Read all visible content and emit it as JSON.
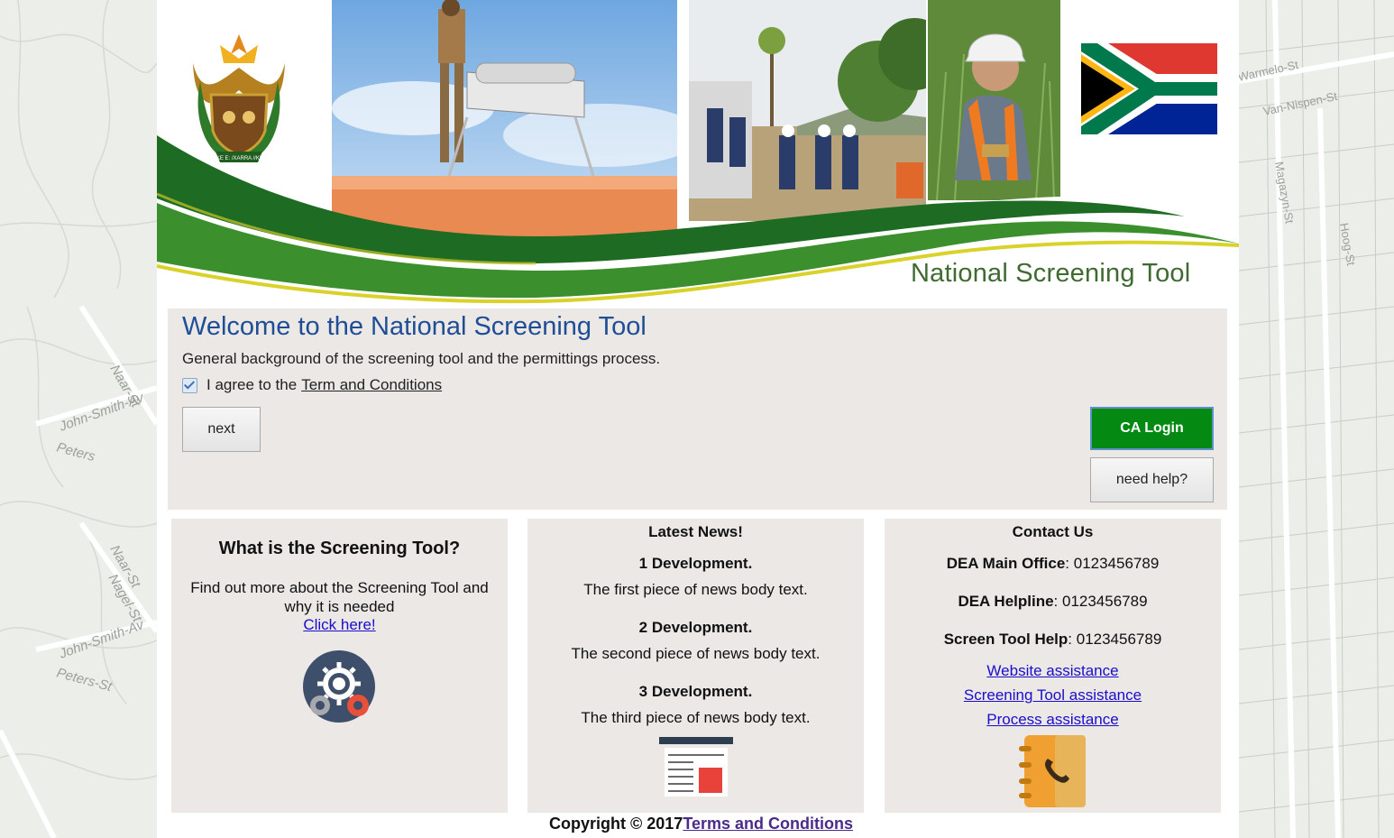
{
  "banner": {
    "title": "National Screening Tool",
    "coat_of_arms_motto": "!KE E: /XARRA //KE"
  },
  "welcome": {
    "heading": "Welcome to the National Screening Tool",
    "background_text": "General background of the screening tool and the permittings process.",
    "agree_prefix": "I agree to the",
    "agree_link": "Term and Conditions",
    "agree_checked": true,
    "next_label": "next",
    "ca_login_label": "CA Login",
    "need_help_label": "need help?"
  },
  "cards": {
    "what": {
      "heading": "What is the Screening Tool?",
      "text": "Find out more about the Screening Tool and why it is needed",
      "link": "Click here!",
      "icon": "gears-icon"
    },
    "news": {
      "heading": "Latest News!",
      "items": [
        {
          "title": "1 Development.",
          "body": "The first piece of news body text."
        },
        {
          "title": "2 Development.",
          "body": "The second piece of news body text."
        },
        {
          "title": "3 Development.",
          "body": "The third piece of news body text."
        }
      ],
      "icon": "news-document-icon"
    },
    "contact": {
      "heading": "Contact Us",
      "entries": [
        {
          "label": "DEA Main Office",
          "value": ": 0123456789"
        },
        {
          "label": "DEA Helpline",
          "value": ": 0123456789"
        },
        {
          "label": "Screen Tool Help",
          "value": ": 0123456789"
        }
      ],
      "links": [
        "Website assistance",
        "Screening Tool assistance",
        "Process assistance"
      ],
      "icon": "phone-book-icon"
    }
  },
  "footer": {
    "copyright": "Copyright © 2017",
    "terms_link": "Terms and Conditions"
  },
  "map_labels": {
    "left": [
      "Naar-St",
      "John-Smith-Av",
      "Peters",
      "Naar-St",
      "Nagel-St",
      "John-Smith-Av",
      "Peters-St"
    ],
    "right": [
      "Warmelo-St",
      "Van-Nispen-St",
      "Magazyn-St",
      "Hoog-St"
    ]
  },
  "colors": {
    "accent_blue": "#1f4e96",
    "ca_login_green": "#048a12",
    "banner_green": "#1e6b23",
    "panel_grey": "#ebe8e6"
  }
}
